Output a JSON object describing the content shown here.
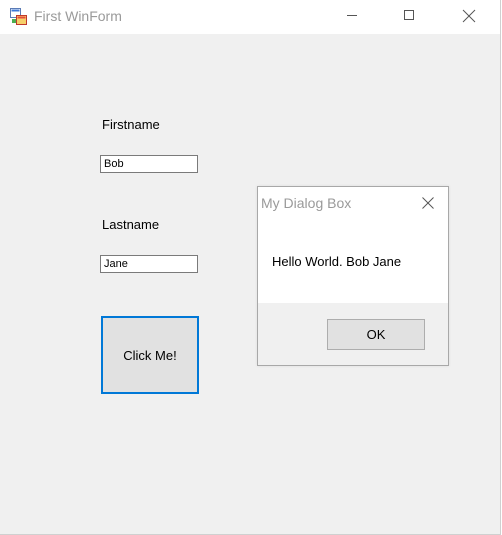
{
  "window": {
    "title": "First WinForm",
    "icon": "winforms-app-icon",
    "controls": [
      "minimize-icon",
      "maximize-icon",
      "close-icon"
    ]
  },
  "form": {
    "firstname_label": "Firstname",
    "firstname_value": "Bob",
    "lastname_label": "Lastname",
    "lastname_value": "Jane",
    "button_label": "Click Me!"
  },
  "dialog": {
    "title": "My Dialog Box",
    "message": "Hello World. Bob Jane",
    "ok_label": "OK",
    "close_icon": "close-icon"
  },
  "colors": {
    "focus_border": "#0078d7",
    "client_background": "#f0f0f0",
    "button_face": "#e1e1e1"
  }
}
